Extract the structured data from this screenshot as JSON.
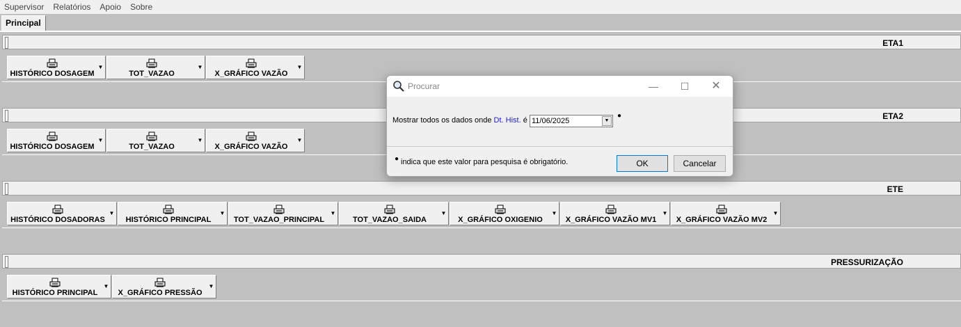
{
  "menu": [
    "Supervisor",
    "Relatórios",
    "Apoio",
    "Sobre"
  ],
  "tab": {
    "label": "Principal"
  },
  "sections": [
    {
      "title": "ETA1",
      "buttons": [
        "HISTÓRICO DOSAGEM",
        "TOT_VAZAO",
        "X_GRÁFICO VAZÃO"
      ]
    },
    {
      "title": "ETA2",
      "buttons": [
        "HISTÓRICO DOSAGEM",
        "TOT_VAZAO",
        "X_GRÁFICO VAZÃO"
      ]
    },
    {
      "title": "ETE",
      "buttons": [
        "HISTÓRICO DOSADORAS",
        "HISTÓRICO PRINCIPAL",
        "TOT_VAZAO_PRINCIPAL",
        "TOT_VAZAO_SAIDA",
        "X_GRÁFICO OXIGENIO",
        "X_GRÁFICO VAZÃO MV1",
        "X_GRÁFICO VAZÃO MV2"
      ]
    },
    {
      "title": "PRESSURIZAÇÃO",
      "buttons": [
        "HISTÓRICO PRINCIPAL",
        "X_GRÁFICO PRESSÃO"
      ]
    }
  ],
  "dialog": {
    "title": "Procurar",
    "prompt_prefix": "Mostrar todos os dados onde",
    "field": "Dt. Hist.",
    "operator": "é",
    "date_value": "11/06/2025",
    "note": "indica que este valor para pesquisa é obrigatório.",
    "ok_label": "OK",
    "cancel_label": "Cancelar"
  }
}
